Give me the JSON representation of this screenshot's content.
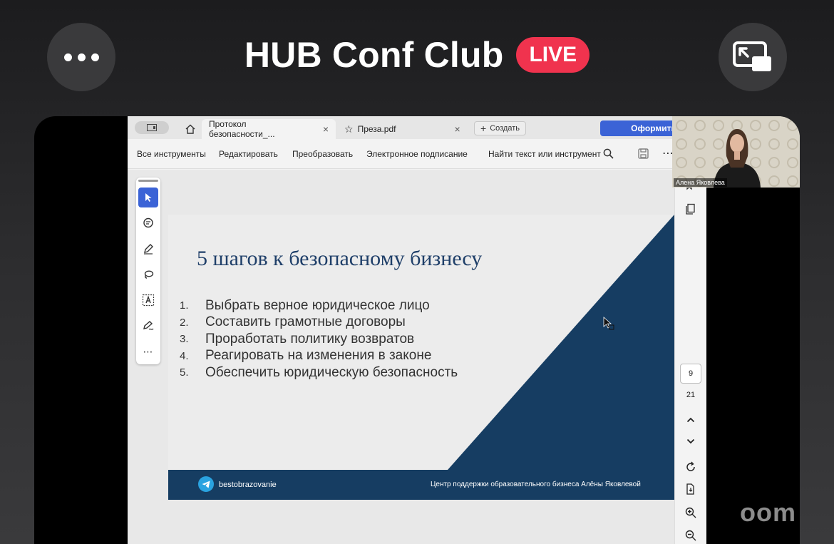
{
  "header": {
    "title": "HUB Conf Club",
    "live_badge": "LIVE",
    "more_icon": "more-horizontal-icon",
    "pip_icon": "picture-in-picture-icon"
  },
  "acrobat": {
    "tabs": [
      {
        "label": "Протокол безопасности_...",
        "close": "×"
      },
      {
        "label": "Преза.pdf",
        "close": "×"
      }
    ],
    "new_tab_label": "Создать",
    "primary_button": "Оформить",
    "menu": [
      "Все инструменты",
      "Редактировать",
      "Преобразовать",
      "Электронное подписание"
    ],
    "search_label": "Найти текст или инструмент",
    "page_current": "9",
    "page_total": "21"
  },
  "slide": {
    "title": "5 шагов к безопасному бизнесу",
    "steps": [
      {
        "num": "1.",
        "text": "Выбрать верное юридическое лицо"
      },
      {
        "num": "2.",
        "text": "Составить грамотные договоры"
      },
      {
        "num": "3.",
        "text": "Проработать политику возвратов"
      },
      {
        "num": "4.",
        "text": "Реагировать на изменения в законе"
      },
      {
        "num": "5.",
        "text": "Обеспечить юридическую безопасность"
      }
    ],
    "footer_handle": "bestobrazovanie",
    "footer_right": "Центр поддержки образовательного бизнеса Алёны Яковлевой",
    "accent_color": "#163d62"
  },
  "webcam": {
    "name": "Алена Яковлева"
  },
  "watermark": "oom",
  "colors": {
    "live": "#f0334e",
    "acrobat_blue": "#3b63d6",
    "slide_navy": "#163d62"
  }
}
